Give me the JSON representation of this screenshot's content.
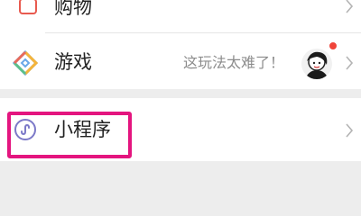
{
  "menu": {
    "shopping": {
      "label": "购物",
      "icon": "shopping-bag-icon"
    },
    "games": {
      "label": "游戏",
      "icon": "games-diamond-icon",
      "hint": "这玩法太难了！",
      "avatar": "avatar",
      "badge": "red-dot"
    },
    "mini_programs": {
      "label": "小程序",
      "icon": "mini-program-icon"
    }
  },
  "colors": {
    "background": "#ededed",
    "highlight": "#e4157f",
    "badge": "#f0443a",
    "mini_icon": "#7c79c8"
  }
}
